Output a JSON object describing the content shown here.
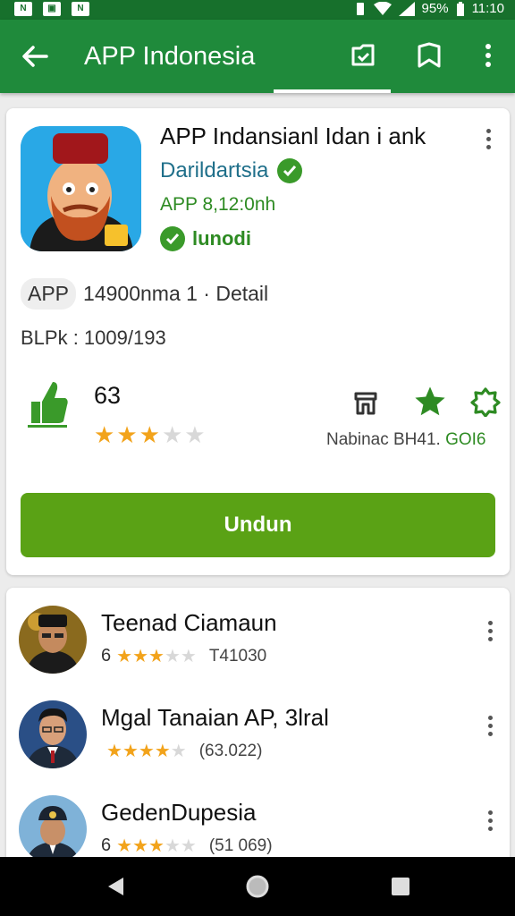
{
  "status": {
    "battery": "95%",
    "time": "11:10"
  },
  "app_bar": {
    "title": "APP Indonesia"
  },
  "app": {
    "name": "APP Indansianl Idan i ank",
    "developer": "Darildartsia",
    "meta": "APP 8,12:0nh",
    "installed": "lunodi",
    "chip": "APP",
    "detail": "14900nma 1 · Detail",
    "size": "BLPk : 1009/193",
    "rating": "63",
    "stars": 3,
    "action_label": "Nabinac BH41.",
    "action_label_green": "GOI6",
    "install_button": "Undun"
  },
  "list": [
    {
      "name": "Teenad Ciamaun",
      "rating": "6",
      "stars": 3,
      "count": "T41030"
    },
    {
      "name": "Mgal Tanaian AP, 3lral",
      "rating": "",
      "stars": 4,
      "count": "(63.022)"
    },
    {
      "name": "GedenDupesia",
      "rating": "6",
      "stars": 3,
      "count": "(51 069)"
    }
  ],
  "colors": {
    "app_bar": "#1f8a3b",
    "status_bar": "#17702c",
    "install": "#5aa215",
    "star": "#f2a31b"
  }
}
